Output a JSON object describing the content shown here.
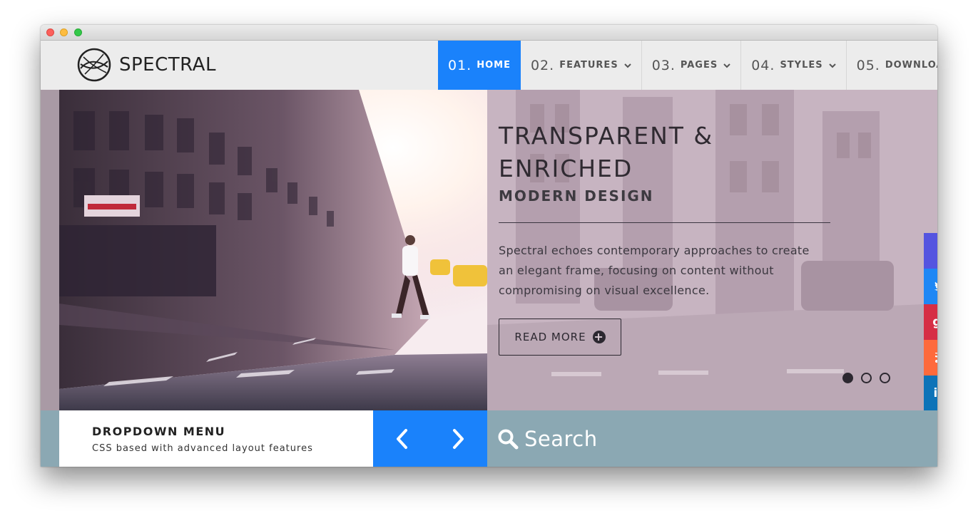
{
  "window": {
    "title": ""
  },
  "brand": {
    "name": "SPECTRAL"
  },
  "nav": {
    "items": [
      {
        "num": "01.",
        "label": "HOME",
        "dropdown": false,
        "active": true
      },
      {
        "num": "02.",
        "label": "FEATURES",
        "dropdown": true,
        "active": false
      },
      {
        "num": "03.",
        "label": "PAGES",
        "dropdown": true,
        "active": false
      },
      {
        "num": "04.",
        "label": "STYLES",
        "dropdown": true,
        "active": false
      },
      {
        "num": "05.",
        "label": "DOWNLOAD",
        "dropdown": false,
        "active": false
      }
    ]
  },
  "hero": {
    "title_line1": "TRANSPARENT &",
    "title_line2": "ENRICHED",
    "subtitle": "MODERN DESIGN",
    "description": "Spectral echoes contemporary approaches to create an elegant frame, focusing on content without compromising on visual excellence.",
    "cta_label": "READ MORE",
    "cta_icon": "plus-circle-icon",
    "slides": 3,
    "active_slide": 1
  },
  "social": [
    {
      "name": "facebook",
      "glyph": "f",
      "color": "#5454e0"
    },
    {
      "name": "twitter",
      "glyph": "t",
      "color": "#1e87f5"
    },
    {
      "name": "google-plus",
      "glyph": "g+",
      "color": "#d62e45"
    },
    {
      "name": "rss",
      "glyph": "rss",
      "color": "#fe6a3c"
    },
    {
      "name": "linkedin",
      "glyph": "in",
      "color": "#0d73b8"
    }
  ],
  "bottom": {
    "info_title": "DROPDOWN MENU",
    "info_subtitle": "CSS based with advanced layout features",
    "search_label": "Search"
  },
  "colors": {
    "accent": "#1a82fb",
    "bottom_bar": "#8ba8b3",
    "header_bg": "#ececec"
  }
}
